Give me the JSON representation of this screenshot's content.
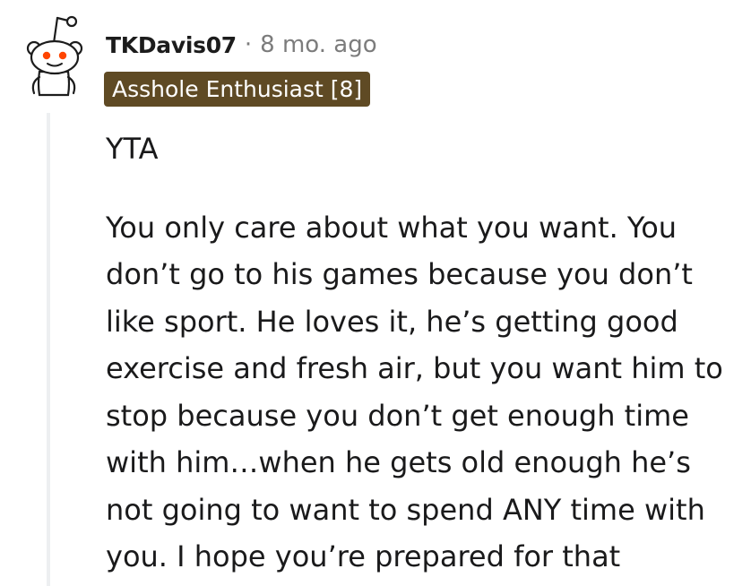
{
  "comment": {
    "username": "TKDavis07",
    "separator": "·",
    "timestamp": "8 mo. ago",
    "flair": "Asshole Enthusiast [8]",
    "avatar_icon": "snoo-avatar-icon",
    "paragraphs": [
      "YTA",
      "You only care about what you want. You don’t go to his games because you don’t like sport. He loves it, he’s getting good exercise and fresh air, but you want him to stop because you don’t get enough time with him…when he gets old enough he’s not going to want to spend ANY time with you. I hope you’re prepared for that"
    ]
  },
  "colors": {
    "flair_background": "#5f4a24",
    "flair_text": "#ffffff",
    "meta_text": "#7c7c7c",
    "body_text": "#1a1a1b",
    "thread_line": "#edeff1",
    "avatar_accent": "#ff4500"
  }
}
